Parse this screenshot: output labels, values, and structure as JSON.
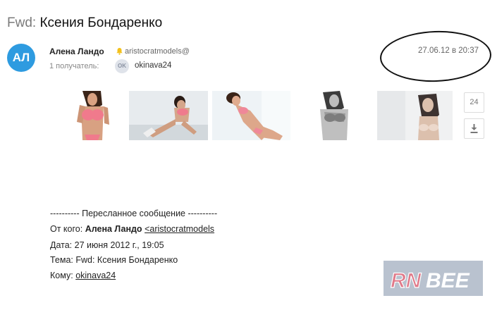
{
  "message": {
    "subject_prefix": "Fwd:",
    "subject_text": "Ксения Бондаренко",
    "avatar_initials": "АЛ",
    "sender_name": "Алена Ландо",
    "sender_email": "aristocratmodels@",
    "recipients_label": "1 получатель:",
    "recipient_initials": "OK",
    "recipient_email": "okinava24",
    "date": "27.06.12 в 20:37"
  },
  "attachments": {
    "count": "24",
    "thumbnails": [
      {
        "name": "photo-1"
      },
      {
        "name": "photo-2"
      },
      {
        "name": "photo-3"
      },
      {
        "name": "photo-4"
      },
      {
        "name": "photo-5"
      }
    ]
  },
  "forwarded": {
    "separator": "---------- Пересланное сообщение ----------",
    "from_label": "От кого:",
    "from_name": "Алена Ландо",
    "from_email": "<aristocratmodels",
    "date_line": "Дата: 27 июня 2012 г., 19:05",
    "subject_line": "Тема: Fwd: Ксения Бондаренко",
    "to_label": "Кому:",
    "to_email": "okinava24"
  },
  "watermark": {
    "text": "RNBEE"
  }
}
